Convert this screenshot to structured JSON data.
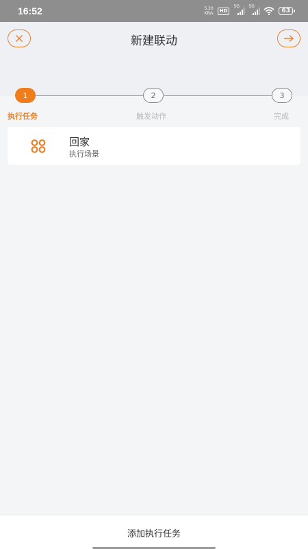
{
  "status_bar": {
    "time": "16:52",
    "net_speed_value": "5.20",
    "net_speed_unit": "KB/s",
    "hd_label": "HD",
    "signal1_label": "5G",
    "signal2_label": "5G",
    "battery": "63"
  },
  "header": {
    "title": "新建联动",
    "close_icon": "close-icon",
    "next_icon": "arrow-right-icon"
  },
  "stepper": {
    "steps": [
      {
        "number": "1",
        "label": "执行任务",
        "active": true
      },
      {
        "number": "2",
        "label": "触发动作",
        "active": false
      },
      {
        "number": "3",
        "label": "完成",
        "active": false
      }
    ]
  },
  "tasks": [
    {
      "icon": "scene-icon",
      "title": "回家",
      "subtitle": "执行场景"
    }
  ],
  "bottom": {
    "add_label": "添加执行任务"
  },
  "colors": {
    "accent": "#ef7d1b",
    "status_bar": "#8e8e8e",
    "header_bg": "#eef0f4"
  }
}
